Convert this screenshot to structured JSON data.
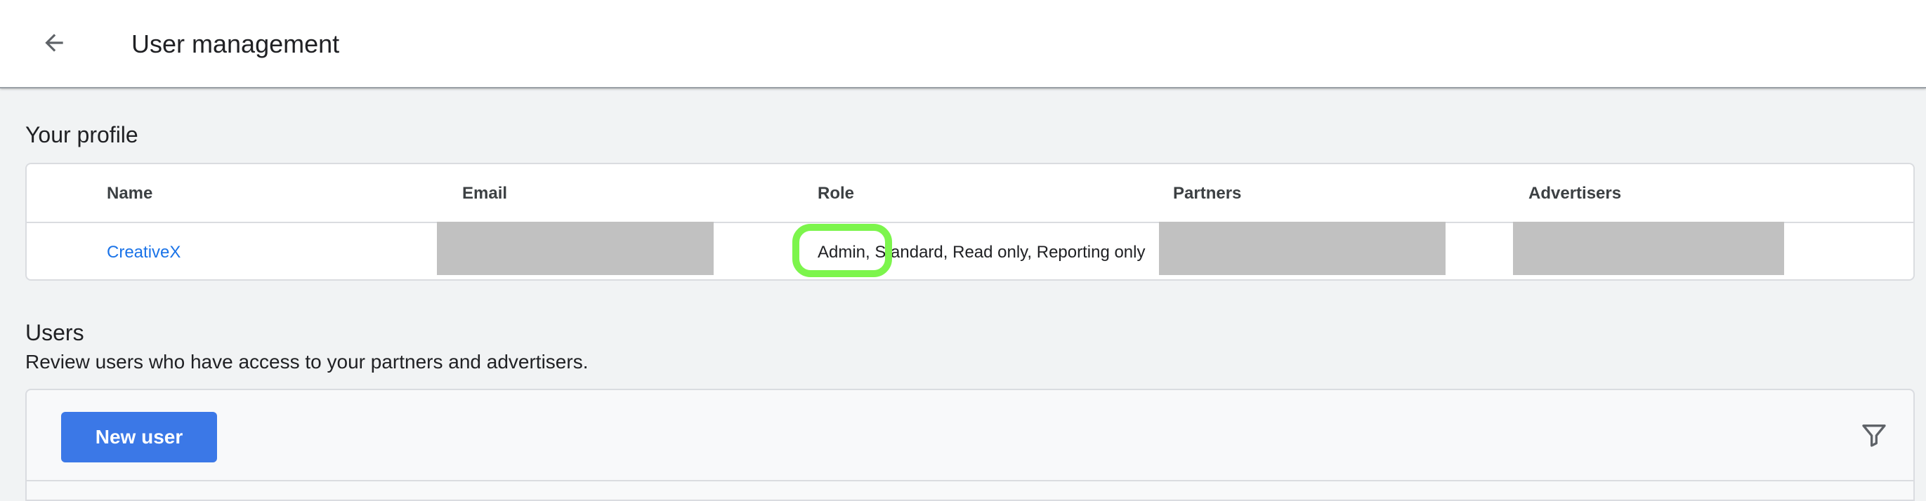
{
  "header": {
    "back_icon": "arrow-back-icon",
    "title": "User management"
  },
  "profile": {
    "section_title": "Your profile",
    "columns": [
      "Name",
      "Email",
      "Role",
      "Partners",
      "Advertisers"
    ],
    "row": {
      "name": "CreativeX",
      "role": "Admin, Standard, Read only, Reporting only"
    }
  },
  "users": {
    "section_title": "Users",
    "description": "Review users who have access to your partners and advertisers.",
    "new_user_label": "New user",
    "filter_icon": "filter-icon"
  },
  "colors": {
    "accent": "#1a73e8",
    "button": "#3b78e7",
    "highlight": "#7cf54c",
    "redaction": "#c1c1c1"
  }
}
